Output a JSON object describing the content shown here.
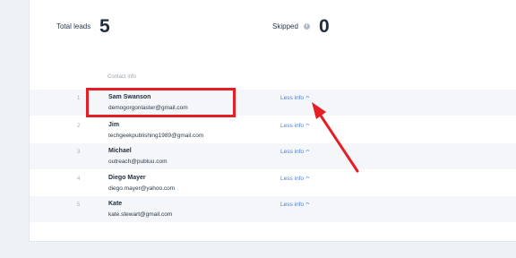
{
  "stats": {
    "total_leads_label": "Total leads",
    "total_leads_value": "5",
    "skipped_label": "Skipped",
    "skipped_value": "0"
  },
  "table": {
    "column_header": "Contact info",
    "rows": [
      {
        "num": "1",
        "name": "Sam Swanson",
        "email": "demogorgonlaster@gmail.com",
        "action": "Less info"
      },
      {
        "num": "2",
        "name": "Jim",
        "email": "techgeekpublishing1989@gmail.com",
        "action": "Less info"
      },
      {
        "num": "3",
        "name": "Michael",
        "email": "outreach@publuu.com",
        "action": "Less info"
      },
      {
        "num": "4",
        "name": "Diego Mayer",
        "email": "diego.mayer@yahoo.com",
        "action": "Less info"
      },
      {
        "num": "5",
        "name": "Kate",
        "email": "kate.stewart@gmail.com",
        "action": "Less info"
      }
    ]
  },
  "icons": {
    "info": "info-icon",
    "chevron": "chevron-up-icon"
  },
  "colors": {
    "highlight": "#e31e24",
    "link": "#4a7fd4",
    "text": "#1f2d3d"
  }
}
